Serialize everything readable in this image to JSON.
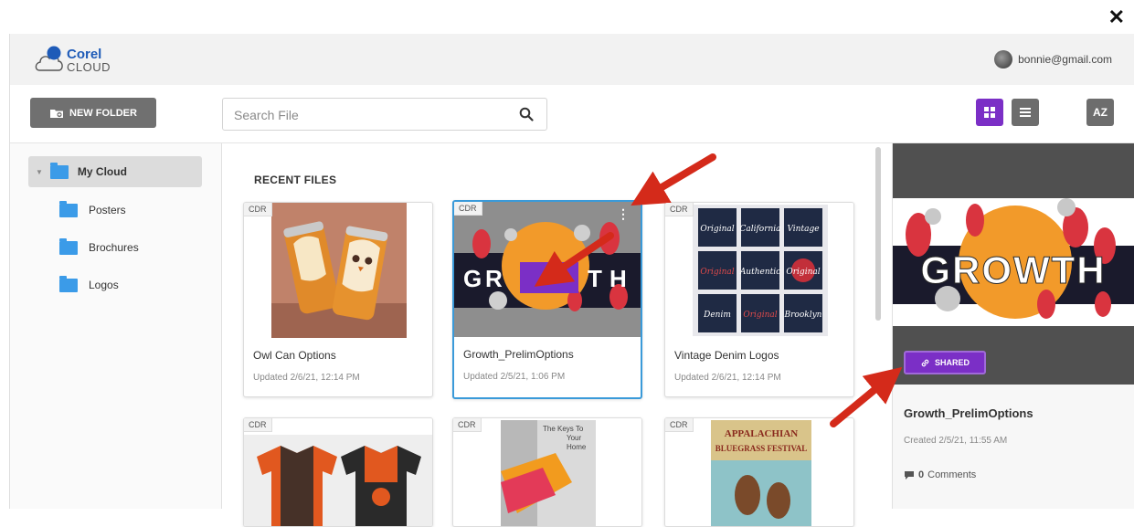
{
  "window": {
    "close_symbol": "✕"
  },
  "brand": {
    "name_line1": "Corel",
    "name_line2": "CLOUD",
    "registered": "®"
  },
  "user": {
    "email": "bonnie@gmail.com"
  },
  "toolbar": {
    "new_folder_label": "NEW FOLDER",
    "search_placeholder": "Search File",
    "sort_label": "AZ",
    "accent": "#7b2fc6"
  },
  "sidebar": {
    "root": "My Cloud",
    "folders": [
      "Posters",
      "Brochures",
      "Logos"
    ],
    "folder_color": "#3b9be8"
  },
  "main": {
    "section_title": "RECENT FILES",
    "files": [
      {
        "badge": "CDR",
        "name": "Owl Can Options",
        "updated": "Updated 2/6/21, 12:14 PM"
      },
      {
        "badge": "CDR",
        "name": "Growth_PrelimOptions",
        "updated": "Updated 2/5/21, 1:06 PM"
      },
      {
        "badge": "CDR",
        "name": "Vintage Denim Logos",
        "updated": "Updated 2/6/21, 12:14 PM"
      },
      {
        "badge": "CDR"
      },
      {
        "badge": "CDR",
        "poster_line1": "The Keys To",
        "poster_line2": "Your",
        "poster_line3": "Home"
      },
      {
        "badge": "CDR",
        "poster_line1": "APPALACHIAN",
        "poster_line2": "BLUEGRASS FESTIVAL"
      }
    ]
  },
  "details": {
    "thumb_word": "GROWTH",
    "shared_label": "SHARED",
    "file_name": "Growth_PrelimOptions",
    "created": "Created 2/5/21, 11:55 AM",
    "comments_count": "0",
    "comments_label": "Comments"
  },
  "thumbnails": {
    "growth_letters": [
      "G",
      "R",
      "T",
      "H"
    ],
    "vintage_labels": [
      "Original",
      "California",
      "Vintage",
      "Original",
      "Authentic",
      "Original",
      "Denim",
      "Original",
      "Brooklyn"
    ]
  }
}
